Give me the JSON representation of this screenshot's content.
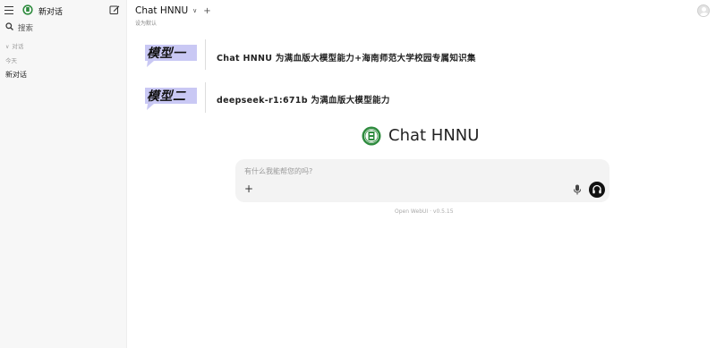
{
  "sidebar": {
    "new_chat_label": "新对话",
    "search_label": "搜索",
    "section_label": "对话",
    "today_label": "今天",
    "chats": [
      "新对话"
    ]
  },
  "header": {
    "model_name": "Chat HNNU",
    "set_default": "设为默认"
  },
  "models": [
    {
      "badge": "模型一",
      "description": "Chat HNNU 为满血版大模型能力+海南师范大学校园专属知识集"
    },
    {
      "badge": "模型二",
      "description": "deepseek-r1:671b 为满血版大模型能力"
    }
  ],
  "hero": {
    "title": "Chat HNNU"
  },
  "input": {
    "placeholder": "有什么我能帮您的吗?"
  },
  "footer": {
    "version": "Open WebUI · v0.5.15"
  },
  "colors": {
    "badge_accent": "#c9c8f4",
    "logo_green": "#2e8b3e"
  }
}
